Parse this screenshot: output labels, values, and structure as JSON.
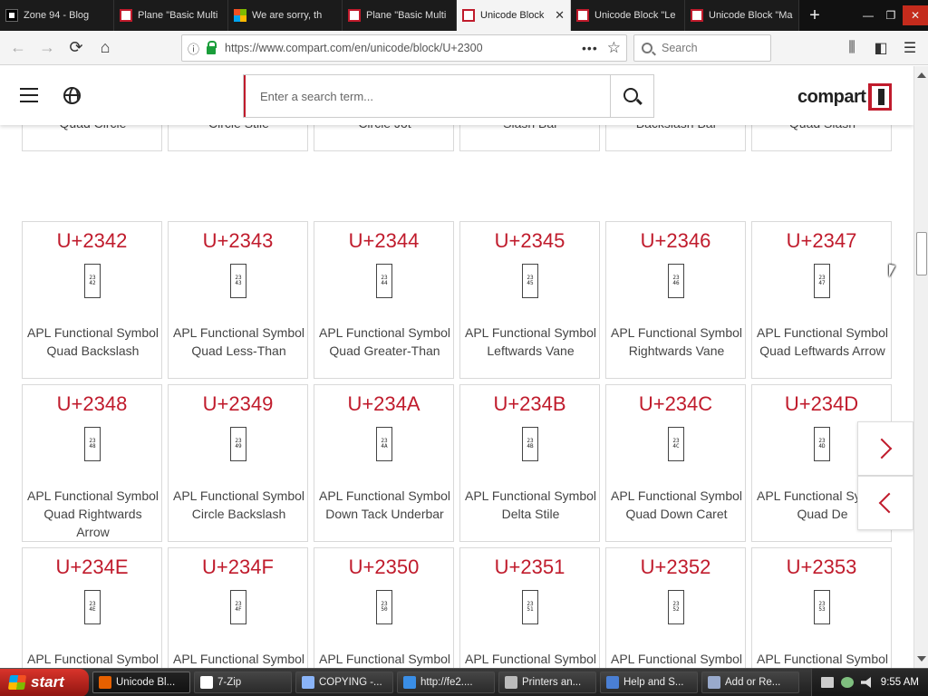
{
  "browser": {
    "tabs": [
      {
        "title": "Zone 94 - Blog",
        "favicon": "zone94-icon",
        "active": false
      },
      {
        "title": "Plane \"Basic Multi",
        "favicon": "compart-icon",
        "active": false
      },
      {
        "title": "We are sorry, th",
        "favicon": "microsoft-icon",
        "active": false
      },
      {
        "title": "Plane \"Basic Multi",
        "favicon": "compart-icon",
        "active": false
      },
      {
        "title": "Unicode Block",
        "favicon": "compart-icon",
        "active": true
      },
      {
        "title": "Unicode Block \"Le",
        "favicon": "compart-icon",
        "active": false
      },
      {
        "title": "Unicode Block \"Ma",
        "favicon": "compart-icon",
        "active": false
      }
    ],
    "new_tab_label": "+",
    "url": "https://www.compart.com/en/unicode/block/U+2300",
    "search_placeholder": "Search",
    "page_actions": "•••"
  },
  "site": {
    "search_placeholder": "Enter a search term...",
    "logo_text": "compart"
  },
  "partial_row_names": [
    "APL Functional Symbol Quad Circle",
    "APL Functional Symbol Circle Stile",
    "APL Functional Symbol Circle Jot",
    "APL Functional Symbol Slash Bar",
    "APL Functional Symbol Backslash Bar",
    "APL Functional Symbol Quad Slash"
  ],
  "cards": [
    {
      "code": "U+2342",
      "hex": "2342",
      "name": "APL Functional Symbol Quad Backslash"
    },
    {
      "code": "U+2343",
      "hex": "2343",
      "name": "APL Functional Symbol Quad Less-Than"
    },
    {
      "code": "U+2344",
      "hex": "2344",
      "name": "APL Functional Symbol Quad Greater-Than"
    },
    {
      "code": "U+2345",
      "hex": "2345",
      "name": "APL Functional Symbol Leftwards Vane"
    },
    {
      "code": "U+2346",
      "hex": "2346",
      "name": "APL Functional Symbol Rightwards Vane"
    },
    {
      "code": "U+2347",
      "hex": "2347",
      "name": "APL Functional Symbol Quad Leftwards Arrow"
    },
    {
      "code": "U+2348",
      "hex": "2348",
      "name": "APL Functional Symbol Quad Rightwards Arrow"
    },
    {
      "code": "U+2349",
      "hex": "2349",
      "name": "APL Functional Symbol Circle Backslash"
    },
    {
      "code": "U+234A",
      "hex": "234A",
      "name": "APL Functional Symbol Down Tack Underbar"
    },
    {
      "code": "U+234B",
      "hex": "234B",
      "name": "APL Functional Symbol Delta Stile"
    },
    {
      "code": "U+234C",
      "hex": "234C",
      "name": "APL Functional Symbol Quad Down Caret"
    },
    {
      "code": "U+234D",
      "hex": "234D",
      "name": "APL Functional Symbol Quad De"
    },
    {
      "code": "U+234E",
      "hex": "234E",
      "name": "APL Functional Symbol Down Tack"
    },
    {
      "code": "U+234F",
      "hex": "234F",
      "name": "APL Functional Symbol Upwards"
    },
    {
      "code": "U+2350",
      "hex": "2350",
      "name": "APL Functional Symbol Quad"
    },
    {
      "code": "U+2351",
      "hex": "2351",
      "name": "APL Functional Symbol Up Tack"
    },
    {
      "code": "U+2352",
      "hex": "2352",
      "name": "APL Functional Symbol Del Stile"
    },
    {
      "code": "U+2353",
      "hex": "2353",
      "name": "APL Functional Symbol Quad Up"
    }
  ],
  "taskbar": {
    "start_label": "start",
    "buttons": [
      {
        "label": "Unicode Bl...",
        "icon": "firefox-icon",
        "active": true
      },
      {
        "label": "7-Zip",
        "icon": "7zip-icon",
        "active": false
      },
      {
        "label": "COPYING -...",
        "icon": "notepad-icon",
        "active": false
      },
      {
        "label": "http://fe2....",
        "icon": "ie-icon",
        "active": false
      },
      {
        "label": "Printers an...",
        "icon": "printer-icon",
        "active": false
      },
      {
        "label": "Help and S...",
        "icon": "help-icon",
        "active": false
      },
      {
        "label": "Add or Re...",
        "icon": "add-remove-icon",
        "active": false
      }
    ],
    "clock": "9:55 AM"
  },
  "colors": {
    "accent": "#c01b2c",
    "tab_bar": "#111111",
    "taskbar": "#2a2a2a",
    "start_button": "#c62a22"
  }
}
